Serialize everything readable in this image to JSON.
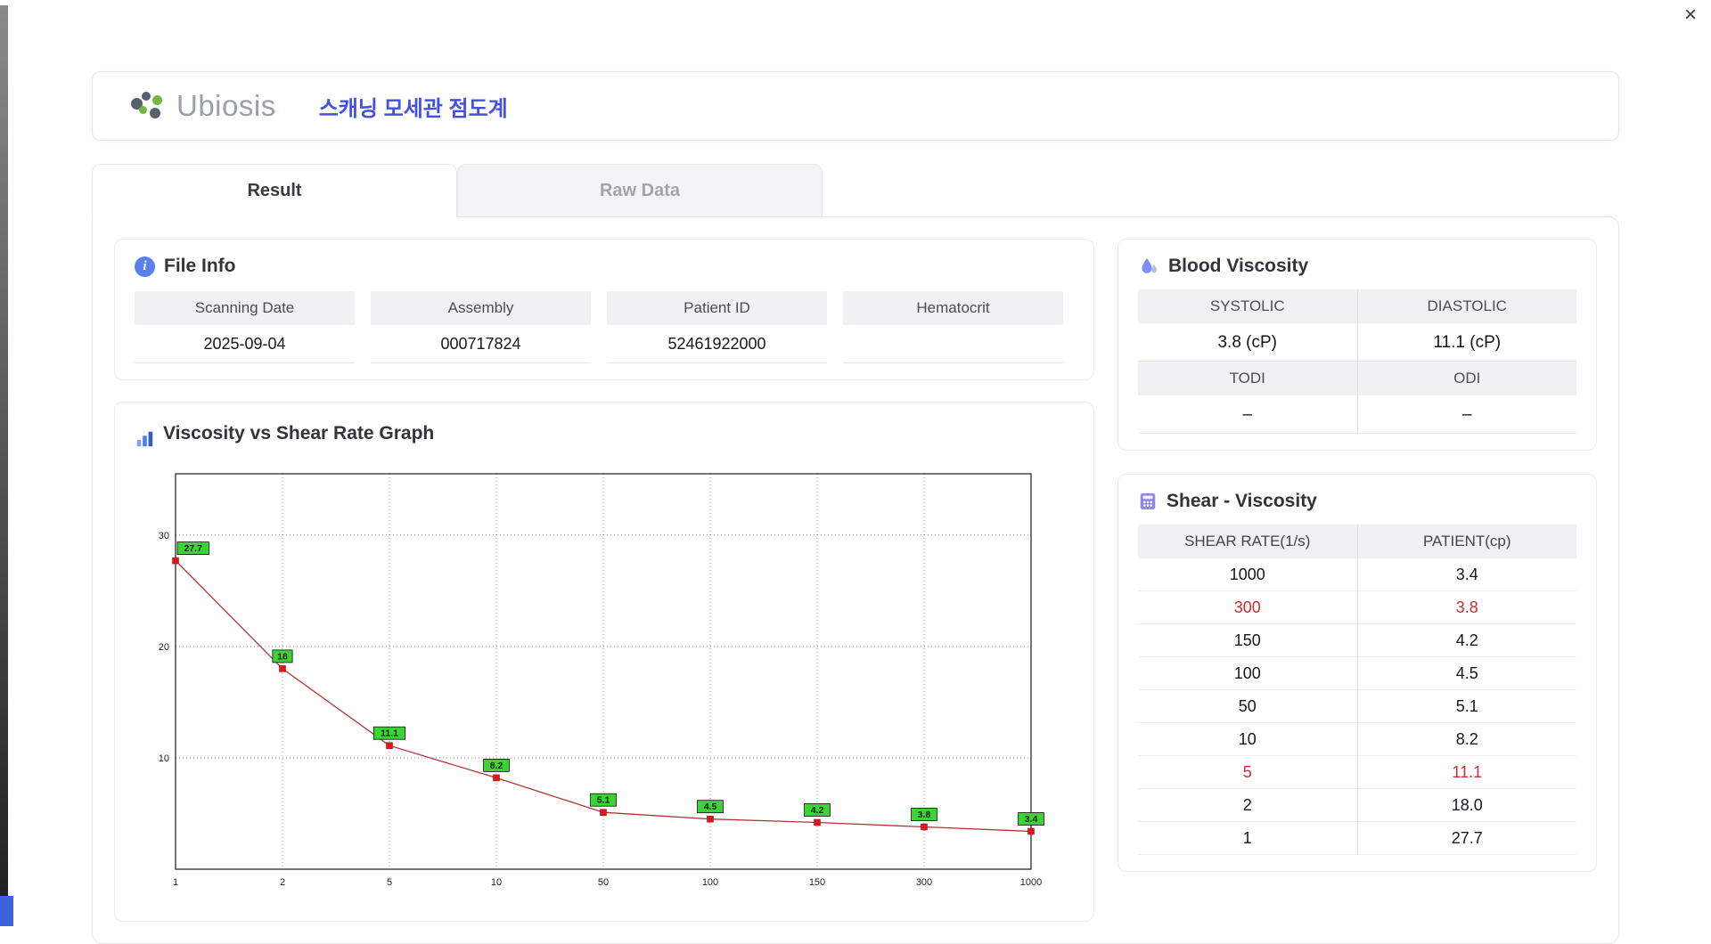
{
  "window": {
    "close_label": "×"
  },
  "header": {
    "logo_text": "Ubiosis",
    "title": "스캐닝 모세관 점도계"
  },
  "tabs": [
    {
      "label": "Result",
      "active": true
    },
    {
      "label": "Raw Data",
      "active": false
    }
  ],
  "file_info": {
    "title": "File Info",
    "fields": [
      {
        "label": "Scanning Date",
        "value": "2025-09-04"
      },
      {
        "label": "Assembly",
        "value": "000717824"
      },
      {
        "label": "Patient ID",
        "value": "52461922000"
      },
      {
        "label": "Hematocrit",
        "value": ""
      }
    ]
  },
  "graph_section": {
    "title": "Viscosity vs Shear Rate Graph"
  },
  "blood_viscosity": {
    "title": "Blood Viscosity",
    "systolic_label": "SYSTOLIC",
    "systolic_value": "3.8 (cP)",
    "diastolic_label": "DIASTOLIC",
    "diastolic_value": "11.1 (cP)",
    "todi_label": "TODI",
    "todi_value": "–",
    "odi_label": "ODI",
    "odi_value": "–"
  },
  "shear_viscosity": {
    "title": "Shear - Viscosity",
    "columns": [
      "SHEAR RATE(1/s)",
      "PATIENT(cp)"
    ],
    "rows": [
      {
        "shear": "1000",
        "patient": "3.4",
        "highlight": false
      },
      {
        "shear": "300",
        "patient": "3.8",
        "highlight": true
      },
      {
        "shear": "150",
        "patient": "4.2",
        "highlight": false
      },
      {
        "shear": "100",
        "patient": "4.5",
        "highlight": false
      },
      {
        "shear": "50",
        "patient": "5.1",
        "highlight": false
      },
      {
        "shear": "10",
        "patient": "8.2",
        "highlight": false
      },
      {
        "shear": "5",
        "patient": "11.1",
        "highlight": true
      },
      {
        "shear": "2",
        "patient": "18.0",
        "highlight": false
      },
      {
        "shear": "1",
        "patient": "27.7",
        "highlight": false
      }
    ]
  },
  "chart_data": {
    "type": "line",
    "title": "Viscosity vs Shear Rate Graph",
    "x_ticks": [
      "1",
      "2",
      "5",
      "10",
      "50",
      "100",
      "150",
      "300",
      "1000"
    ],
    "x_scale": "equally-spaced labeled ticks (log-like shear rate axis)",
    "values": [
      27.7,
      18,
      11.1,
      8.2,
      5.1,
      4.5,
      4.2,
      3.8,
      3.4
    ],
    "point_labels": [
      "27.7",
      "18",
      "11.1",
      "8.2",
      "5.1",
      "4.5",
      "4.2",
      "3.8",
      "3.4"
    ],
    "xlabel": "",
    "ylabel": "",
    "y_ticks": [
      10,
      20,
      30
    ],
    "ylim": [
      0,
      35.5
    ],
    "grid": true,
    "legend": "none",
    "line_color": "#b23535",
    "marker_color": "#e01717",
    "point_label_bg": "#3bd435"
  },
  "colors": {
    "accent_blue": "#4451e0",
    "highlight_red": "#c4303c",
    "header_gray_bg": "#f1f1f4",
    "border": "#e8e8ec"
  }
}
